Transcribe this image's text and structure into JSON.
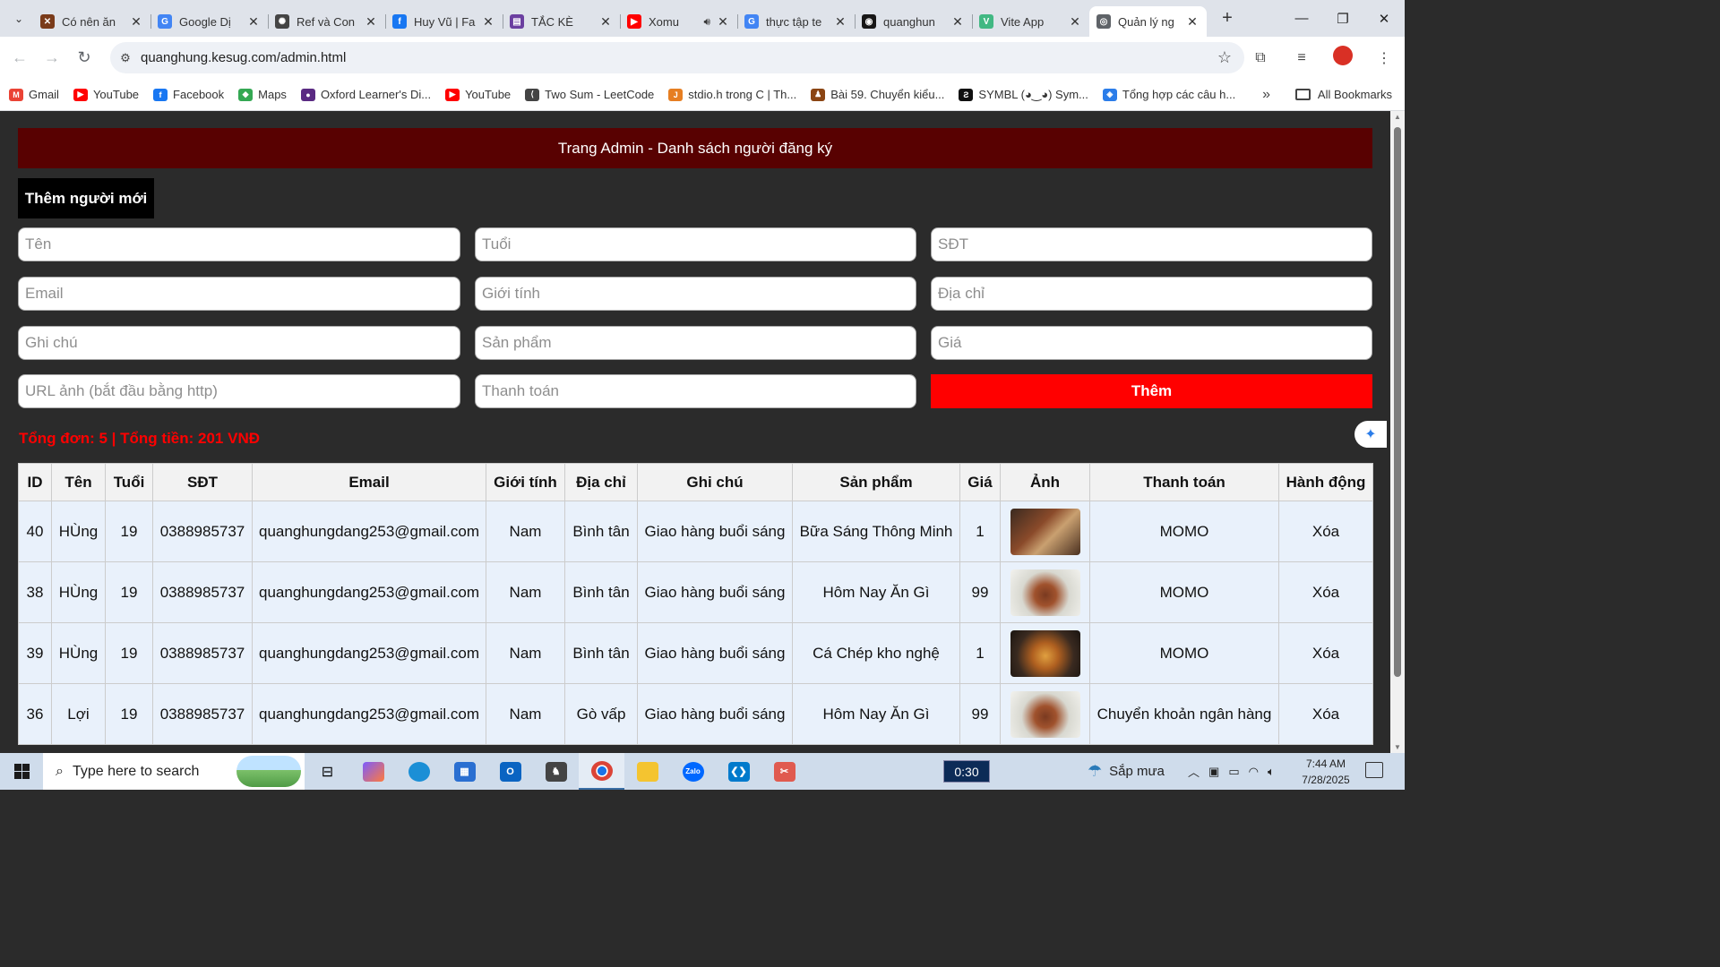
{
  "browser": {
    "tabs": [
      {
        "title": "Có nên ăn",
        "fav_color": "#7a3b1a",
        "fav": "✕"
      },
      {
        "title": "Google Dị",
        "fav_color": "#4285f4",
        "fav": "G"
      },
      {
        "title": "Ref và Con",
        "fav_color": "#444444",
        "fav": "✺"
      },
      {
        "title": "Huy Vũ | Fa",
        "fav_color": "#1877f2",
        "fav": "f"
      },
      {
        "title": "TẮC KÈ",
        "fav_color": "#6b3fa0",
        "fav": "▤"
      },
      {
        "title": "Xomu",
        "fav_color": "#ff0000",
        "fav": "▶"
      },
      {
        "title": "thực tập te",
        "fav_color": "#4285f4",
        "fav": "G"
      },
      {
        "title": "quanghun",
        "fav_color": "#181717",
        "fav": "◉"
      },
      {
        "title": "Vite App",
        "fav_color": "#41b883",
        "fav": "V"
      },
      {
        "title": "Quản lý ng",
        "fav_color": "#5f6368",
        "fav": "◎"
      }
    ],
    "address": "quanghung.kesug.com/admin.html",
    "bookmarks": [
      {
        "label": "Gmail",
        "color": "#ea4335",
        "glyph": "M"
      },
      {
        "label": "YouTube",
        "color": "#ff0000",
        "glyph": "▶"
      },
      {
        "label": "Facebook",
        "color": "#1877f2",
        "glyph": "f"
      },
      {
        "label": "Maps",
        "color": "#34a853",
        "glyph": "◆"
      },
      {
        "label": "Oxford Learner's Di...",
        "color": "#5a2a82",
        "glyph": "●"
      },
      {
        "label": "YouTube",
        "color": "#ff0000",
        "glyph": "▶"
      },
      {
        "label": "Two Sum - LeetCode",
        "color": "#444444",
        "glyph": "⟨"
      },
      {
        "label": "stdio.h trong C | Th...",
        "color": "#e67e22",
        "glyph": "J"
      },
      {
        "label": "Bài 59. Chuyển kiểu...",
        "color": "#8b4513",
        "glyph": "♟"
      },
      {
        "label": "SYMBL (◕‿◕) Sym...",
        "color": "#111111",
        "glyph": "Ƨ"
      },
      {
        "label": "Tổng hợp các câu h...",
        "color": "#2b7de9",
        "glyph": "◈"
      }
    ],
    "all_bookmarks": "All Bookmarks"
  },
  "page": {
    "header": "Trang Admin - Danh sách người đăng ký",
    "add_title": "Thêm người mới",
    "placeholders": {
      "name": "Tên",
      "age": "Tuổi",
      "phone": "SĐT",
      "email": "Email",
      "gender": "Giới tính",
      "address": "Địa chỉ",
      "note": "Ghi chú",
      "product": "Sản phẩm",
      "price": "Giá",
      "image_url": "URL ảnh (bắt đầu bằng http)",
      "payment": "Thanh toán"
    },
    "submit_label": "Thêm",
    "summary": "Tổng đơn: 5 | Tổng tiền: 201 VNĐ",
    "table": {
      "headers": [
        "ID",
        "Tên",
        "Tuổi",
        "SĐT",
        "Email",
        "Giới tính",
        "Địa chỉ",
        "Ghi chú",
        "Sản phẩm",
        "Giá",
        "Ảnh",
        "Thanh toán",
        "Hành động"
      ],
      "rows": [
        {
          "id": "40",
          "name": "HÙng",
          "age": "19",
          "phone": "0388985737",
          "email": "quanghungdang253@gmail.com",
          "gender": "Nam",
          "address": "Bình tân",
          "note": "Giao hàng buổi sáng",
          "product": "Bữa Sáng Thông Minh",
          "price": "1",
          "image": "food-image",
          "payment": "MOMO",
          "action": "Xóa"
        },
        {
          "id": "38",
          "name": "HÙng",
          "age": "19",
          "phone": "0388985737",
          "email": "quanghungdang253@gmail.com",
          "gender": "Nam",
          "address": "Bình tân",
          "note": "Giao hàng buổi sáng",
          "product": "Hôm Nay Ăn Gì",
          "price": "99",
          "image": "food-image",
          "payment": "MOMO",
          "action": "Xóa"
        },
        {
          "id": "39",
          "name": "HÙng",
          "age": "19",
          "phone": "0388985737",
          "email": "quanghungdang253@gmail.com",
          "gender": "Nam",
          "address": "Bình tân",
          "note": "Giao hàng buổi sáng",
          "product": "Cá Chép kho nghệ",
          "price": "1",
          "image": "food-image",
          "payment": "MOMO",
          "action": "Xóa"
        },
        {
          "id": "36",
          "name": "Lợi",
          "age": "19",
          "phone": "0388985737",
          "email": "quanghungdang253@gmail.com",
          "gender": "Nam",
          "address": "Gò vấp",
          "note": "Giao hàng buổi sáng",
          "product": "Hôm Nay Ăn Gì",
          "price": "99",
          "image": "food-image",
          "payment": "Chuyển khoản ngân hàng",
          "action": "Xóa"
        }
      ]
    }
  },
  "taskbar": {
    "search_placeholder": "Type here to search",
    "timer": "0:30",
    "weather": "Sắp mưa",
    "time": "7:44 AM",
    "date": "7/28/2025"
  }
}
